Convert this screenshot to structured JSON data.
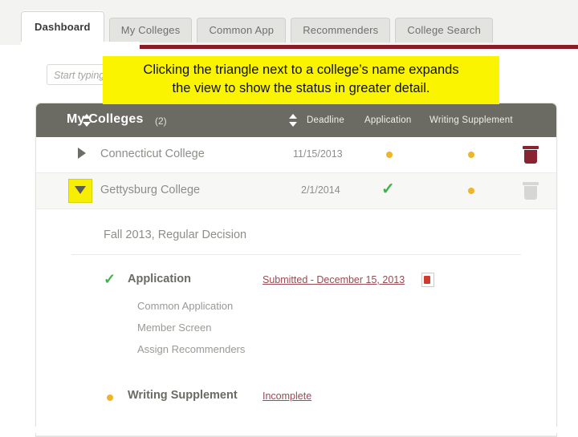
{
  "nav": {
    "tabs": [
      {
        "label": "Dashboard",
        "active": true
      },
      {
        "label": "My Colleges",
        "active": false
      },
      {
        "label": "Common App",
        "active": false
      },
      {
        "label": "Recommenders",
        "active": false
      },
      {
        "label": "College Search",
        "active": false
      }
    ]
  },
  "search": {
    "placeholder": "Start typing a college name"
  },
  "annotation": {
    "line1": "Clicking the triangle next to a college’s name expands",
    "line2": "the view to show the status in greater detail."
  },
  "table": {
    "title": "My Colleges",
    "count": "(2)",
    "columns": {
      "deadline": "Deadline",
      "application": "Application",
      "writing_supplement": "Writing Supplement"
    },
    "rows": [
      {
        "name": "Connecticut College",
        "deadline": "11/15/2013",
        "application_status": "pending",
        "writing_supplement_status": "pending",
        "expanded": false,
        "delete_style": "red"
      },
      {
        "name": "Gettysburg College",
        "deadline": "2/1/2014",
        "application_status": "complete",
        "writing_supplement_status": "pending",
        "expanded": true,
        "delete_style": "grey"
      }
    ]
  },
  "detail": {
    "term": "Fall 2013, Regular Decision",
    "application": {
      "label": "Application",
      "status": "Submitted - December 15, 2013",
      "items": [
        "Common Application",
        "Member Screen",
        "Assign Recommenders"
      ]
    },
    "writing_supplement": {
      "label": "Writing Supplement",
      "status": "Incomplete"
    }
  },
  "colors": {
    "accent_bar": "#8b1a27",
    "header_bar": "#6b6b64",
    "pending": "#f0b429",
    "complete": "#3cb54a",
    "highlight": "#fbf400",
    "link": "#9a4a52"
  }
}
